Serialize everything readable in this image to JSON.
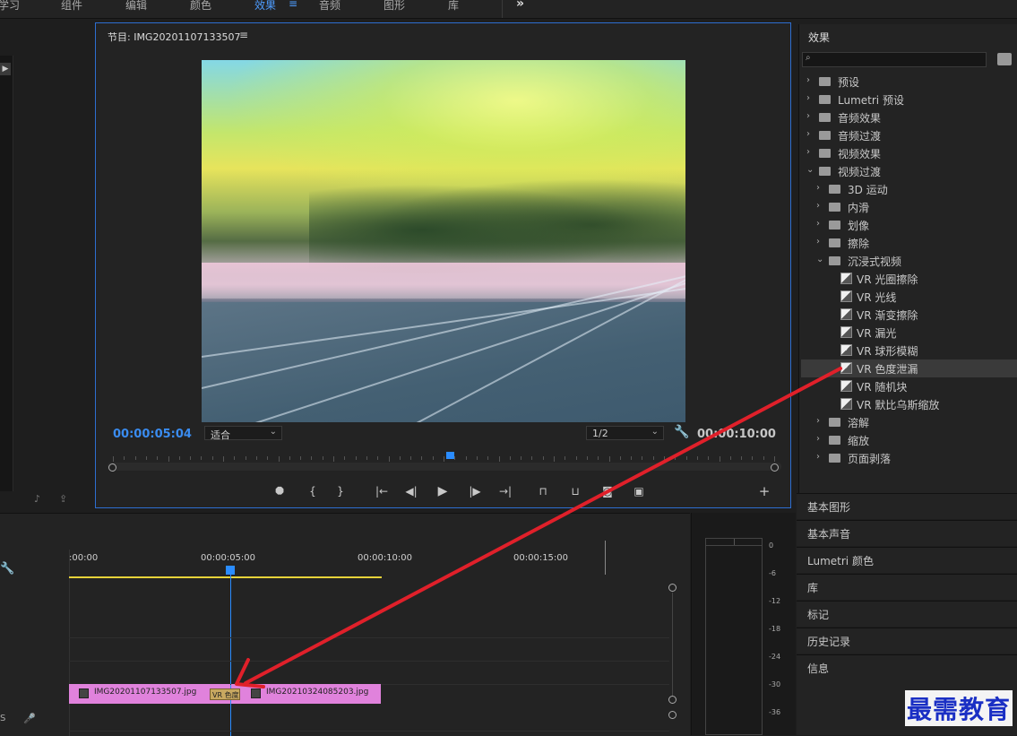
{
  "top_menu": [
    "学习",
    "组件",
    "编辑",
    "颜色",
    "效果",
    "音频",
    "图形",
    "库"
  ],
  "top_menu_active": "效果",
  "top_menu_more": "»",
  "program_monitor": {
    "title": "节目: IMG20201107133507",
    "menu_icon": "≡",
    "current_time": "00:00:05:04",
    "fit_select": "适合",
    "resolution_select": "1/2",
    "duration": "00:00:10:00",
    "playhead_fraction": 0.5
  },
  "effects_panel": {
    "title": "效果",
    "tree": [
      {
        "label": "预设",
        "level": 0,
        "expanded": false,
        "type": "preset"
      },
      {
        "label": "Lumetri 预设",
        "level": 0,
        "expanded": false,
        "type": "preset"
      },
      {
        "label": "音频效果",
        "level": 0,
        "expanded": false,
        "type": "folder"
      },
      {
        "label": "音频过渡",
        "level": 0,
        "expanded": false,
        "type": "folder"
      },
      {
        "label": "视频效果",
        "level": 0,
        "expanded": false,
        "type": "folder"
      },
      {
        "label": "视频过渡",
        "level": 0,
        "expanded": true,
        "type": "folder"
      },
      {
        "label": "3D 运动",
        "level": 1,
        "expanded": false,
        "type": "folder"
      },
      {
        "label": "内滑",
        "level": 1,
        "expanded": false,
        "type": "folder"
      },
      {
        "label": "划像",
        "level": 1,
        "expanded": false,
        "type": "folder"
      },
      {
        "label": "擦除",
        "level": 1,
        "expanded": false,
        "type": "folder"
      },
      {
        "label": "沉浸式视频",
        "level": 1,
        "expanded": true,
        "type": "folder"
      },
      {
        "label": "VR 光圈擦除",
        "level": 2,
        "type": "effect"
      },
      {
        "label": "VR 光线",
        "level": 2,
        "type": "effect"
      },
      {
        "label": "VR 渐变擦除",
        "level": 2,
        "type": "effect"
      },
      {
        "label": "VR 漏光",
        "level": 2,
        "type": "effect"
      },
      {
        "label": "VR 球形模糊",
        "level": 2,
        "type": "effect"
      },
      {
        "label": "VR 色度泄漏",
        "level": 2,
        "type": "effect",
        "selected": true
      },
      {
        "label": "VR 随机块",
        "level": 2,
        "type": "effect"
      },
      {
        "label": "VR 默比乌斯缩放",
        "level": 2,
        "type": "effect"
      },
      {
        "label": "溶解",
        "level": 1,
        "expanded": false,
        "type": "folder"
      },
      {
        "label": "缩放",
        "level": 1,
        "expanded": false,
        "type": "folder"
      },
      {
        "label": "页面剥落",
        "level": 1,
        "expanded": false,
        "type": "folder"
      }
    ]
  },
  "side_panels": [
    "基本图形",
    "基本声音",
    "Lumetri 颜色",
    "库",
    "标记",
    "历史记录",
    "信息"
  ],
  "timeline": {
    "ruler_labels": [
      ":00:00",
      "00:00:05:00",
      "00:00:10:00",
      "00:00:15:00"
    ],
    "clips": [
      {
        "name": "IMG20201107133507.jpg"
      },
      {
        "name": "IMG20210324085203.jpg"
      }
    ],
    "transition_label": "VR 色度",
    "track_label": "S"
  },
  "audio_meter": {
    "db_labels": [
      "0",
      "-6",
      "-12",
      "-18",
      "-24",
      "-30",
      "-36"
    ]
  },
  "watermark": "最需教育",
  "colors": {
    "accent": "#2d6ed0",
    "timecode": "#3a8cf0",
    "clip": "#e082dc",
    "arrow": "#e0202a"
  }
}
